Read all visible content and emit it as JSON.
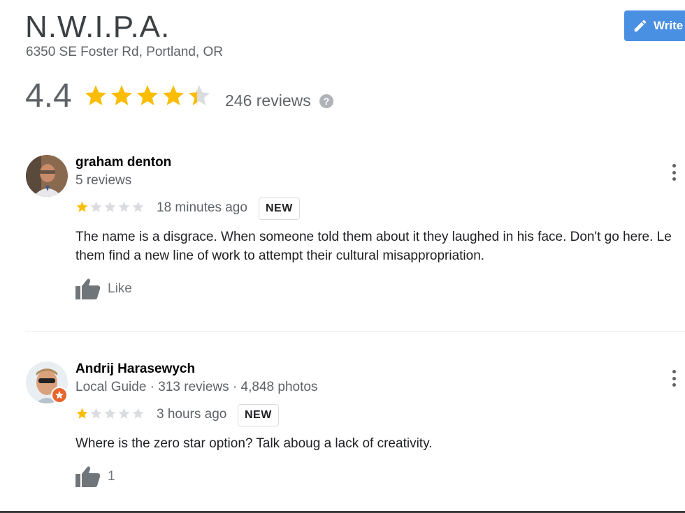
{
  "place": {
    "name": "N.W.I.P.A.",
    "address": "6350 SE Foster Rd, Portland, OR",
    "rating": "4.4",
    "stars": 4.4,
    "reviews_label": "246 reviews",
    "help_symbol": "?",
    "write_label": "Write"
  },
  "colors": {
    "star": "#fbbc04",
    "star_empty": "#dadce0",
    "button": "#4a90e2"
  },
  "reviews": [
    {
      "author": "graham denton",
      "meta": "5 reviews",
      "stars": 1,
      "time": "18 minutes ago",
      "badge": "NEW",
      "text_line1": "The name is a disgrace. When someone told them about it they laughed in his face. Don't go here. Le",
      "text_line2": "them find a new line of work to attempt their cultural misappropriation.",
      "like_label": "Like",
      "icons": [
        "avatar",
        "more-vert-icon",
        "thumbs-up-icon"
      ]
    },
    {
      "author": "Andrij Harasewych",
      "meta": "Local Guide · 313 reviews · 4,848 photos",
      "stars": 1,
      "time": "3 hours ago",
      "badge": "NEW",
      "text_line1": "Where is the zero star option? Talk aboug a lack of creativity.",
      "like_label": "1",
      "icons": [
        "avatar",
        "local-guide-badge-icon",
        "more-vert-icon",
        "thumbs-up-icon"
      ]
    }
  ]
}
